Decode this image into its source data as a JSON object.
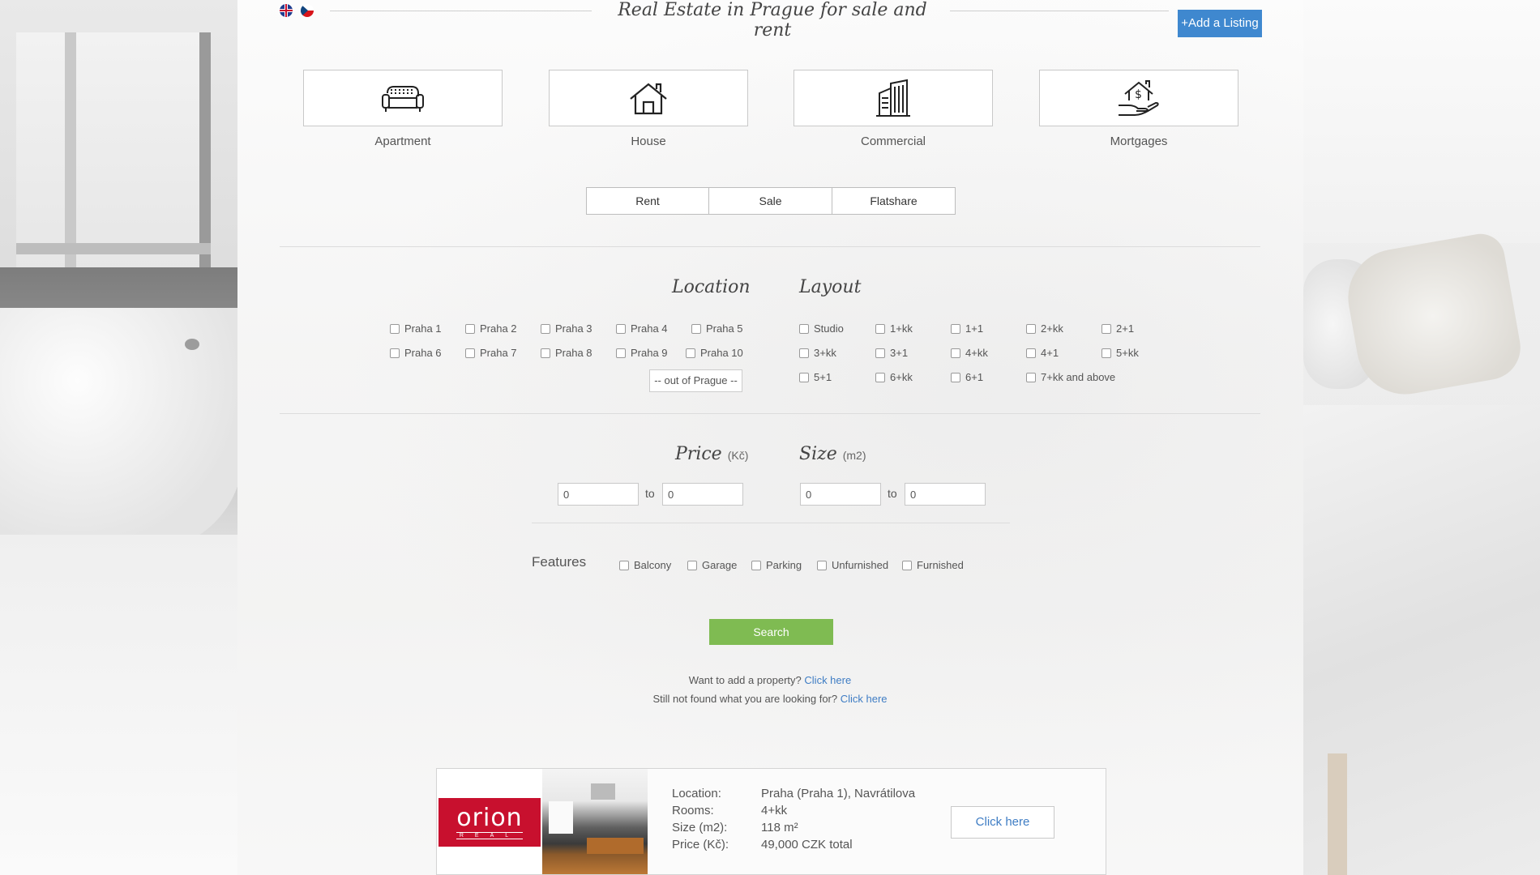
{
  "header": {
    "title": "Real Estate in Prague for sale and rent",
    "add_listing": "+Add a Listing",
    "languages": [
      "English",
      "Czech"
    ]
  },
  "categories": [
    {
      "label": "Apartment",
      "icon": "sofa-icon"
    },
    {
      "label": "House",
      "icon": "house-icon"
    },
    {
      "label": "Commercial",
      "icon": "building-icon"
    },
    {
      "label": "Mortgages",
      "icon": "hand-house-money-icon"
    }
  ],
  "modes": [
    "Rent",
    "Sale",
    "Flatshare"
  ],
  "location": {
    "title": "Location",
    "options": [
      "Praha 1",
      "Praha 2",
      "Praha 3",
      "Praha 4",
      "Praha 5",
      "Praha 6",
      "Praha 7",
      "Praha 8",
      "Praha 9",
      "Praha 10"
    ],
    "out_of_prague": "-- out of Prague --"
  },
  "layout": {
    "title": "Layout",
    "options": [
      "Studio",
      "1+kk",
      "1+1",
      "2+kk",
      "2+1",
      "3+kk",
      "3+1",
      "4+kk",
      "4+1",
      "5+kk",
      "5+1",
      "6+kk",
      "6+1",
      "7+kk and above"
    ]
  },
  "price": {
    "title": "Price",
    "unit": "(Kč)",
    "from": "0",
    "to": "0",
    "to_label": "to"
  },
  "size": {
    "title": "Size",
    "unit": "(m2)",
    "from": "0",
    "to": "0",
    "to_label": "to"
  },
  "features": {
    "label": "Features",
    "options": [
      "Balcony",
      "Garage",
      "Parking",
      "Unfurnished",
      "Furnished"
    ]
  },
  "search_label": "Search",
  "info": {
    "add_text": "Want to add a property?",
    "add_link": "Click here",
    "notfound_text": "Still not found what you are looking for?",
    "notfound_link": "Click here"
  },
  "listing": {
    "logo_text": "orion",
    "logo_sub": "REAL",
    "location_key": "Location:",
    "location_val": "Praha (Praha 1), Navrátilova",
    "rooms_key": "Rooms:",
    "rooms_val": "4+kk",
    "size_key": "Size (m2):",
    "size_val": "118 m²",
    "price_key": "Price (Kč):",
    "price_val": "49,000 CZK total",
    "button": "Click here"
  },
  "colors": {
    "accent_blue": "#3f88cf",
    "search_green": "#7fbb52",
    "link_blue": "#3f7dc4",
    "logo_red": "#c8102e"
  }
}
